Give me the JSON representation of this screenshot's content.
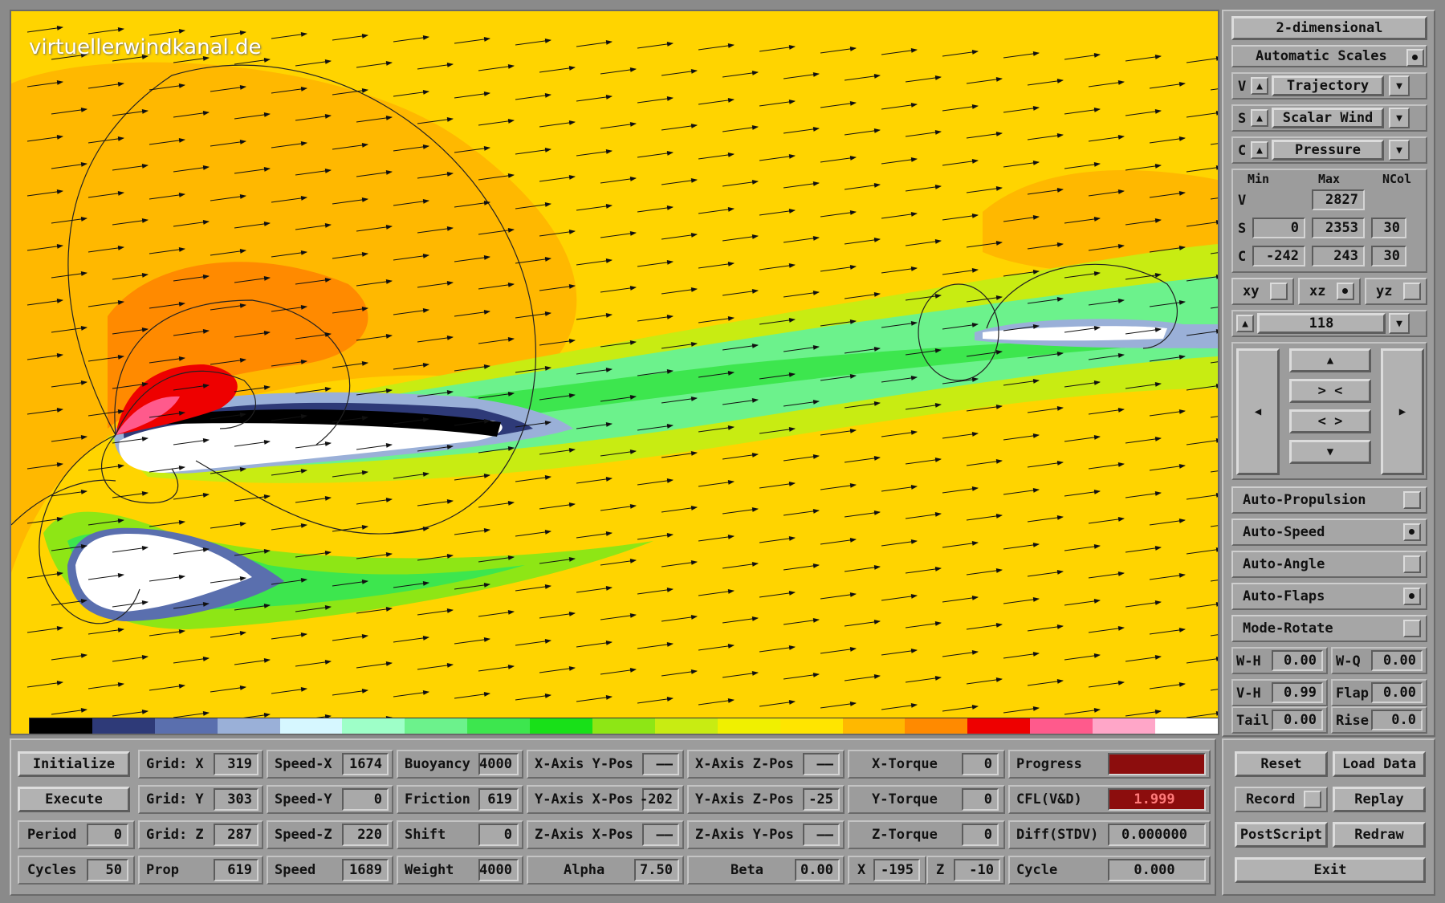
{
  "watermark": "virtuellerwindkanal.de",
  "colorbar": [
    "#000000",
    "#2e3a78",
    "#5a6fae",
    "#9ab0d8",
    "#d6f7ff",
    "#9effc8",
    "#6cf28c",
    "#3de64e",
    "#18e018",
    "#8ee615",
    "#c8ec12",
    "#f0f000",
    "#ffe500",
    "#ffb800",
    "#ff8a00",
    "#ee0000",
    "#ff5a8c",
    "#ffa6c8",
    "#ffffff"
  ],
  "side": {
    "mode_button": "2-dimensional",
    "auto_scales": "Automatic Scales",
    "v_prefix": "V",
    "v_mode": "Trajectory",
    "s_prefix": "S",
    "s_mode": "Scalar Wind",
    "c_prefix": "C",
    "c_mode": "Pressure",
    "hdr_min": "Min",
    "hdr_max": "Max",
    "hdr_ncol": "NCol",
    "row_v": "V",
    "v_max": "2827",
    "row_s": "S",
    "s_min": "0",
    "s_max": "2353",
    "s_ncol": "30",
    "row_c": "C",
    "c_min": "-242",
    "c_max": "243",
    "c_ncol": "30",
    "plane_xy": "xy",
    "plane_xz": "xz",
    "plane_yz": "yz",
    "slice": "118",
    "nav_up": "▲",
    "nav_in": "> <",
    "nav_out": "< >",
    "nav_down": "▼",
    "nav_left": "◀",
    "nav_right": "▶",
    "auto_propulsion": "Auto-Propulsion",
    "auto_speed": "Auto-Speed",
    "auto_angle": "Auto-Angle",
    "auto_flaps": "Auto-Flaps",
    "mode_rotate": "Mode-Rotate",
    "wh_label": "W-H",
    "wh_value": "0.00",
    "wq_label": "W-Q",
    "wq_value": "0.00",
    "vh_label": "V-H",
    "vh_value": "0.99",
    "flap_label": "Flap",
    "flap_value": "0.00",
    "tail_label": "Tail",
    "tail_value": "0.00",
    "rise_label": "Rise",
    "rise_value": "0.0"
  },
  "bottom": {
    "initialize": "Initialize",
    "execute": "Execute",
    "period_label": "Period",
    "period_value": "0",
    "cycles_label": "Cycles",
    "cycles_value": "50",
    "gridx_label": "Grid: X",
    "gridx_value": "319",
    "gridy_label": "Grid: Y",
    "gridy_value": "303",
    "gridz_label": "Grid: Z",
    "gridz_value": "287",
    "prop_label": "Prop",
    "prop_value": "619",
    "speedx_label": "Speed-X",
    "speedx_value": "1674",
    "speedy_label": "Speed-Y",
    "speedy_value": "0",
    "speedz_label": "Speed-Z",
    "speedz_value": "220",
    "speed_label": "Speed",
    "speed_value": "1689",
    "buoyancy_label": "Buoyancy",
    "buoyancy_value": "4000",
    "friction_label": "Friction",
    "friction_value": "619",
    "shift_label": "Shift",
    "shift_value": "0",
    "weight_label": "Weight",
    "weight_value": "4000",
    "xay_label": "X-Axis Y-Pos",
    "xay_value": "——",
    "yax_label": "Y-Axis X-Pos",
    "yax_value": "-202",
    "zax_label": "Z-Axis X-Pos",
    "zax_value": "——",
    "alpha_label": "Alpha",
    "alpha_value": "7.50",
    "xaz_label": "X-Axis Z-Pos",
    "xaz_value": "——",
    "yaz_label": "Y-Axis Z-Pos",
    "yaz_value": "-25",
    "zay_label": "Z-Axis Y-Pos",
    "zay_value": "——",
    "beta_label": "Beta",
    "beta_value": "0.00",
    "xtorque_label": "X-Torque",
    "xtorque_value": "0",
    "ytorque_label": "Y-Torque",
    "ytorque_value": "0",
    "ztorque_label": "Z-Torque",
    "ztorque_value": "0",
    "x_label": "X",
    "x_value": "-195",
    "z_label": "Z",
    "z_value": "-10",
    "progress_label": "Progress",
    "progress_fraction": 1.0,
    "cfl_label": "CFL(V&D)",
    "cfl_value": "1.999",
    "diff_label": "Diff(STDV)",
    "diff_value": "0.000000",
    "cycle_label": "Cycle",
    "cycle_value": "0.000",
    "reset": "Reset",
    "load_data": "Load Data",
    "record": "Record",
    "replay": "Replay",
    "postscript": "PostScript",
    "redraw": "Redraw",
    "exit": "Exit"
  }
}
